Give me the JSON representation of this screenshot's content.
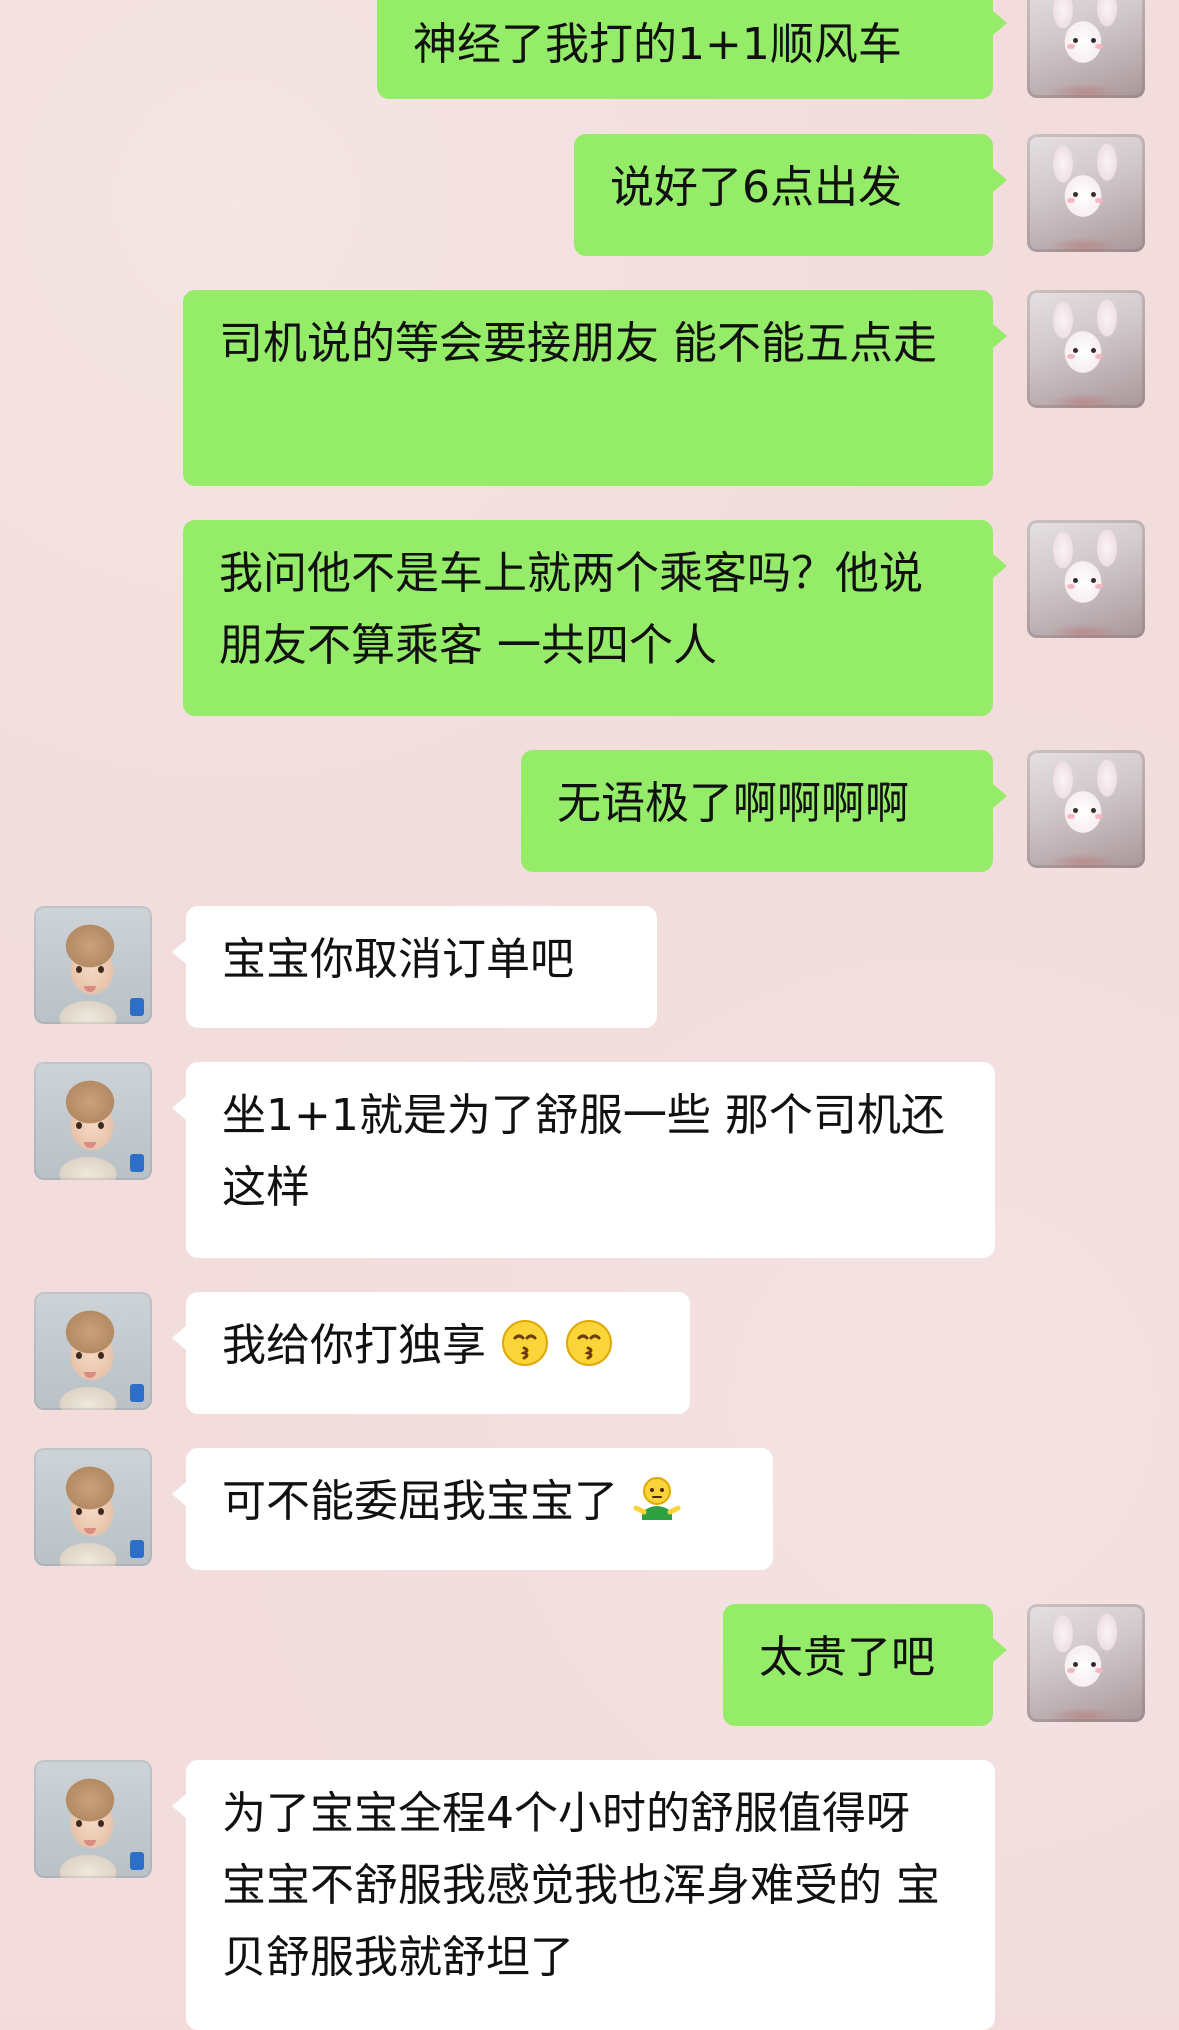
{
  "messages": [
    {
      "side": "right",
      "text": "神经了我打的1+1顺风车"
    },
    {
      "side": "right",
      "text": "说好了6点出发"
    },
    {
      "side": "right",
      "text": "司机说的等会要接朋友 能不能五点走"
    },
    {
      "side": "right",
      "text": "我问他不是车上就两个乘客吗？他说朋友不算乘客 一共四个人"
    },
    {
      "side": "right",
      "text": "无语极了啊啊啊啊"
    },
    {
      "side": "left",
      "text": "宝宝你取消订单吧"
    },
    {
      "side": "left",
      "text": "坐1+1就是为了舒服一些 那个司机还这样"
    },
    {
      "side": "left",
      "text": "我给你打独享"
    },
    {
      "side": "left",
      "text": "可不能委屈我宝宝了"
    },
    {
      "side": "right",
      "text": "太贵了吧"
    },
    {
      "side": "left",
      "text": "为了宝宝全程4个小时的舒服值得呀 宝宝不舒服我感觉我也浑身难受的 宝贝舒服我就舒坦了"
    }
  ],
  "emoji_names": {
    "kiss": "kissing-face-icon",
    "shrug": "shrug-figure-icon"
  },
  "colors": {
    "background": "#f2dcdc",
    "bubble_self": "#95ec69",
    "bubble_other": "#ffffff",
    "text": "#111111"
  }
}
